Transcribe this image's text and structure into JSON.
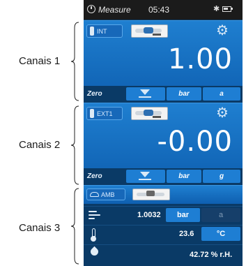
{
  "labels": {
    "ch1": "Canais 1",
    "ch2": "Canais 2",
    "ch3": "Canais 3"
  },
  "status_bar": {
    "mode": "Measure",
    "time": "05:43",
    "bluetooth_icon": "bluetooth-icon",
    "battery_icon": "battery-icon"
  },
  "channel1": {
    "sensor": "INT",
    "value": "1.00",
    "zero_label": "Zero",
    "unit": "bar",
    "mode": "a"
  },
  "channel2": {
    "sensor": "EXT1",
    "value": "-0.00",
    "zero_label": "Zero",
    "unit": "bar",
    "mode": "g"
  },
  "channel3": {
    "sensor": "AMB",
    "pressure_value": "1.0032",
    "pressure_unit": "bar",
    "pressure_mode": "a",
    "temperature_value": "23.6",
    "temperature_unit": "°C",
    "humidity": "42.72 % r.H."
  },
  "colors": {
    "panel": "#1f7fd0",
    "background": "#0a3a66",
    "button": "#1e7ed3"
  }
}
